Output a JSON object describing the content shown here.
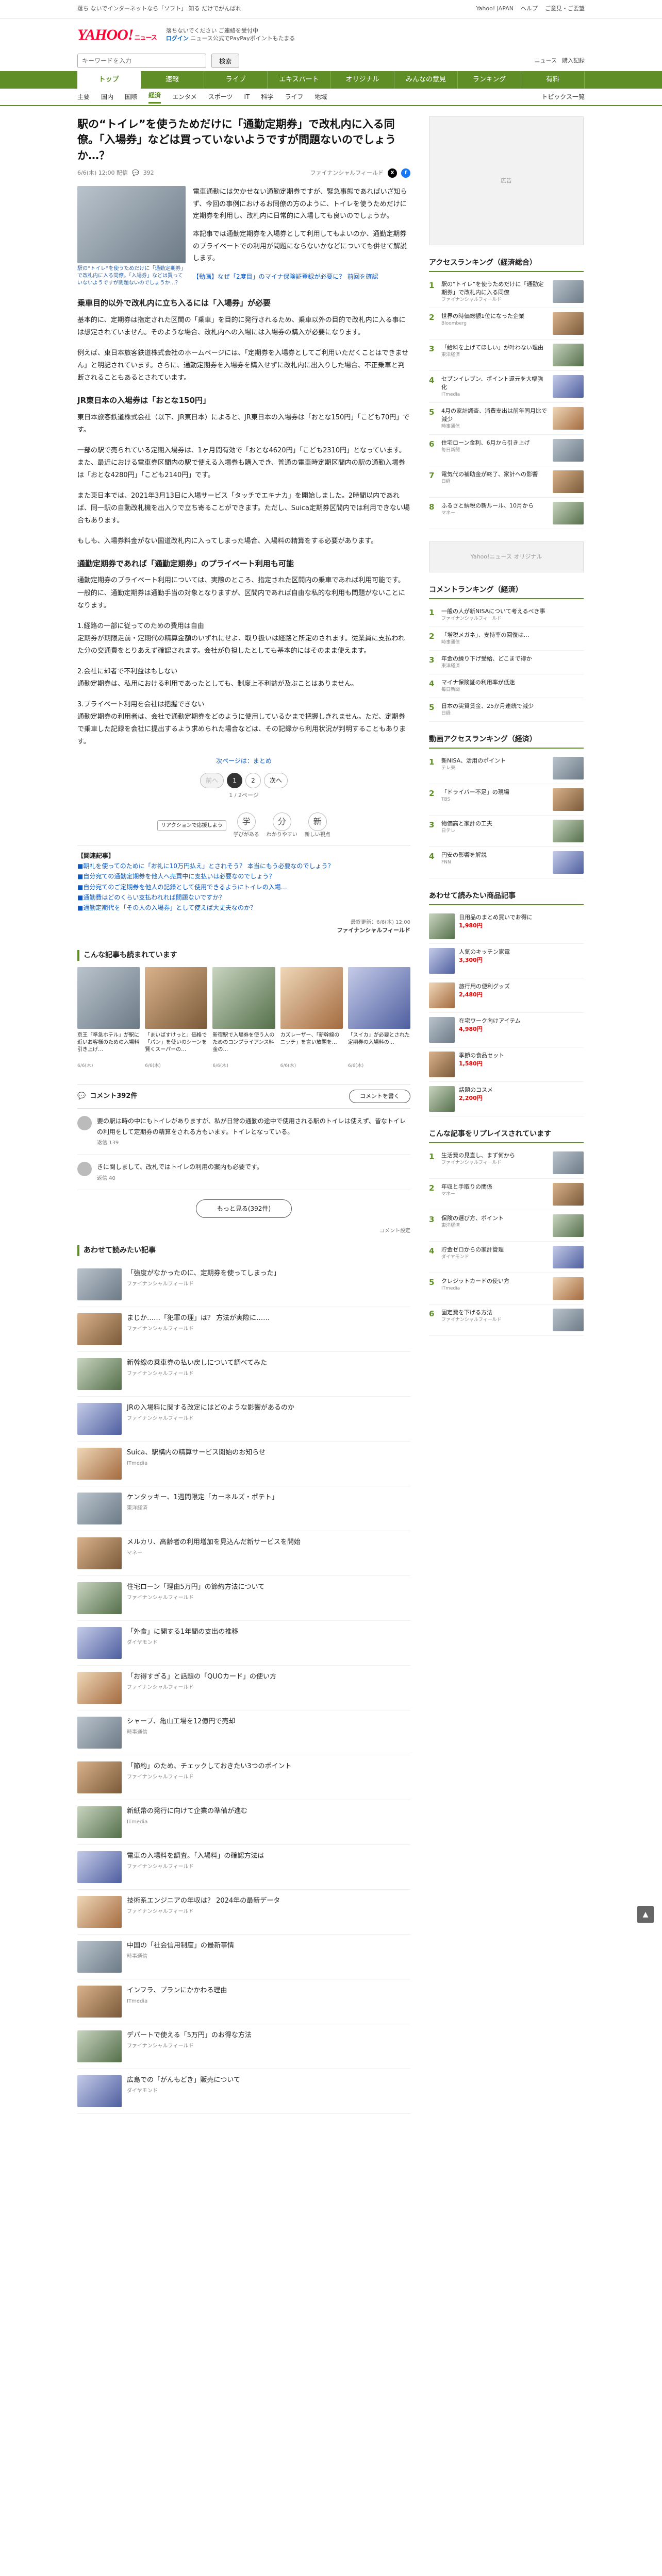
{
  "topbar": {
    "promo": "落ち ないでインターネットなら「ソフト」 知る だけでがんばれ",
    "links": [
      "Yahoo! JAPAN",
      "ヘルプ",
      "ご意見・ご要望"
    ]
  },
  "header": {
    "logo": "YAHOO!",
    "logo_sub": "ニュース",
    "line1": "落ちないでください ご連絡を受付中",
    "line2": "ログイン",
    "line3": "ニュース公式でPayPayポイントもたまる"
  },
  "search": {
    "placeholder": "キーワードを入力",
    "button": "検索",
    "cats": "ニュース",
    "mode": "購入記録"
  },
  "nav": [
    "トップ",
    "速報",
    "ライブ",
    "エキスパート",
    "オリジナル",
    "みんなの意見",
    "ランキング",
    "有料"
  ],
  "subnav": [
    "主要",
    "国内",
    "国際",
    "経済",
    "エンタメ",
    "スポーツ",
    "IT",
    "科学",
    "ライフ",
    "地域"
  ],
  "subnav_active": "経済",
  "subnav_right": "トピックス一覧",
  "article": {
    "title": "駅の“トイレ”を使うためだけに「通勤定期券」で改札内に入る同僚。「入場券」などは買っていないようですが問題ないのでしょうか…？",
    "date": "6/6(木) 12:00 配信",
    "comments_count": "392",
    "source": "ファイナンシャルフィールド",
    "caption": "駅の“トイレ”を使うためだけに「通勤定期券」で改札内に入る同僚。「入場券」などは買っていないようですが問題ないのでしょうか…？",
    "lead_p1": "電車通勤には欠かせない通勤定期券ですが、緊急事態であればいざ知らず、今回の事例におけるお同僚の方のように、トイレを使うためだけに定期券を利用し、改札内に日常的に入場しても良いのでしょうか。",
    "lead_p2": "本記事では通勤定期券を入場券として利用してもよいのか、通勤定期券のプライベートでの利用が問題にならないかなどについても併せて解説します。",
    "lead_link1": "【動画】なぜ「2度目」のマイナ保険証登録が必要に？",
    "lead_link2": "前回を確認",
    "h1": "乗車目的以外で改札内に立ち入るには「入場券」が必要",
    "p1": "基本的に、定期券は指定された区間の「乗車」を目的に発行されるため、乗車以外の目的で改札内に入る事には想定されていません。そのような場合、改札内への入場には入場券の購入が必要になります。",
    "p2": "例えば、東日本旅客鉄道株式会社のホームページには、「定期券を入場券としてご利用いただくことはできません」と明記されています。さらに、通勤定期券を入場券を購入せずに改札内に出入りした場合、不正乗車と判断されることもあるとされています。",
    "h2": "JR東日本の入場券は「おとな150円」",
    "p3": "東日本旅客鉄道株式会社（以下、JR東日本）によると、JR東日本の入場券は「おとな150円」「こども70円」です。",
    "p4": "一部の駅で売られている定期入場券は、1ヶ月間有効で「おとな4620円」「こども2310円」となっています。また、最近における電車券区間内の駅で使える入場券も購入でき、普通の電車時定期区間内の駅の通勤入場券は「おとな4280円」「こども2140円」です。",
    "p5": "また東日本では、2021年3月13日に入場サービス「タッチでエキナカ」を開始しました。2時間以内であれば、同一駅の自動改札機を出入りで立ち寄ることができます。ただし、Suica定期券区間内では利用できない場合もあります。",
    "p6": "もしも、入場券料金がない国道改札内に入ってしまった場合、入場料の精算をする必要があります。",
    "h3": "通勤定期券であれば「通勤定期券」のプライベート利用も可能",
    "p7": "通勤定期券のプライベート利用については、実際のところ、指定された区間内の乗車であれば利用可能です。一般的に、通勤定期券は通勤手当の対象となりますが、区間内であれば自由な私的な利用も問題がないことになります。",
    "p8": "1.経路の一部に従ってのための費用は自由\n定期券が期限走前・定期代の精算金額のいずれにせよ、取り扱いは経路と所定のされます。従業員に支払われた分の交通費をとりあえず確認されます。会社が負担したとしても基本的にはそのまま使えます。",
    "p9": "2.会社に却者で不利益はもしない\n通勤定期券は、私用における利用であったとしても、制度上不利益が及ぶことはありません。",
    "p10": "3.プライベート利用を会社は把握できない\n通勤定期券の利用者は、会社で通勤定期券をどのように使用しているかまで把握しきれません。ただ、定期券で乗車した記録を会社に提出するよう求められた場合などは、その記録から利用状況が判明することもあります。",
    "nextlink": "次ページは：まとめ",
    "pager": {
      "prev": "前へ",
      "p1": "1",
      "p2": "2",
      "next": "次へ",
      "info": "1 / 2ページ"
    },
    "reacts": [
      {
        "icon": "学",
        "label": "学びがある"
      },
      {
        "icon": "分",
        "label": "わかりやすい"
      },
      {
        "icon": "新",
        "label": "新しい視点"
      }
    ],
    "reacts_tip": "リアクションで応援しよう",
    "related_head": "【関連記事】",
    "related": [
      "■朝礼を使ってのために「お礼に10万円払え」とされそう？ 本当にもう必要なのでしょう？",
      "■自分宛ての通勤定期券を他人へ売買中に支払いは必要なのでしょう？",
      "■自分宛てのご定期券を他人の記録として使用できるようにトイレの入場…",
      "■通勤費はどのくらい支払われれば問題ないですか？",
      "■通勤定期代を「その人の入場券」として使えば大丈夫なのか？"
    ],
    "credit_time": "最終更新：6/6(木) 12:00",
    "credit_src": "ファイナンシャルフィールド"
  },
  "readmore": {
    "head": "こんな記事も読まれています",
    "cards": [
      {
        "t": "京王「準急ホテル」が駅に近いお客様のための入場料引き上げ…",
        "d": "6/6(木)"
      },
      {
        "t": "「まいばすけっと」価格で「パン」を使いのシーンを賢くスーパーの…",
        "d": "6/6(木)"
      },
      {
        "t": "新宿駅で入場券を使う人のためのコンプライアンス料金の…",
        "d": "6/6(木)"
      },
      {
        "t": "カズレーザー、「新幹線のニッチ」を言い放題を…",
        "d": "6/6(木)"
      },
      {
        "t": "「スイカ」が必要とされた定期券の入場料の…",
        "d": "6/6(木)"
      }
    ]
  },
  "comments": {
    "head": "コメント392件",
    "write": "コメントを書く",
    "items": [
      {
        "text": "要の駅は時の中にもトイレがありますが、私が日常の通勤の途中で使用される駅のトイレは使えず、皆なトイレの利用をして定期券の精算をされる方もいます。トイレとなっている。",
        "count": "返信 139"
      },
      {
        "text": "きに関しまして、改札ではトイレの利用の案内も必要です。",
        "count": "返信 40"
      }
    ],
    "more": "もっと見る(392件)",
    "mute": "コメント設定"
  },
  "recommend": {
    "head": "あわせて読みたい記事",
    "items": [
      {
        "t": "「強度がなかったのに、定期券を使ってしまった」",
        "s": "ファイナンシャルフィールド"
      },
      {
        "t": "まじか……「犯罪の理」は？ 方法が実際に……",
        "s": "ファイナンシャルフィールド"
      },
      {
        "t": "新幹線の乗車券の払い戻しについて調べてみた",
        "s": "ファイナンシャルフィールド"
      },
      {
        "t": "JRの入場料に関する改定にはどのような影響があるのか",
        "s": "ファイナンシャルフィールド"
      },
      {
        "t": "Suica、駅構内の精算サービス開始のお知らせ",
        "s": "ITmedia"
      },
      {
        "t": "ケンタッキー、1週間限定「カーネルズ・ポテト」",
        "s": "東洋経済"
      },
      {
        "t": "メルカリ、高齢者の利用増加を見込んだ新サービスを開始",
        "s": "マネー"
      },
      {
        "t": "住宅ローン「理由5万円」の節約方法について",
        "s": "ファイナンシャルフィールド"
      },
      {
        "t": "「外食」に関する1年間の支出の推移",
        "s": "ダイヤモンド"
      },
      {
        "t": "「お得すぎる」と話題の「QUOカード」の使い方",
        "s": "ファイナンシャルフィールド"
      },
      {
        "t": "シャープ、亀山工場を12億円で売却",
        "s": "時事通信"
      },
      {
        "t": "「節約」のため、チェックしておきたい3つのポイント",
        "s": "ファイナンシャルフィールド"
      },
      {
        "t": "新紙幣の発行に向けて企業の準備が進む",
        "s": "ITmedia"
      },
      {
        "t": "電車の入場料を調査。「入場料」の確認方法は",
        "s": "ファイナンシャルフィールド"
      },
      {
        "t": "技術系エンジニアの年収は？ 2024年の最新データ",
        "s": "ファイナンシャルフィールド"
      },
      {
        "t": "中国の「社会信用制度」の最新事情",
        "s": "時事通信"
      },
      {
        "t": "インフラ、プランにかかわる理由",
        "s": "ITmedia"
      },
      {
        "t": "デパートで使える「5万円」のお得な方法",
        "s": "ファイナンシャルフィールド"
      },
      {
        "t": "広島での「がんもどき」販売について",
        "s": "ダイヤモンド"
      }
    ]
  },
  "side": {
    "ad1": "広告",
    "access_head": "アクセスランキング（経済総合）",
    "access": [
      {
        "t": "駅の“トイレ”を使うためだけに「通勤定期券」で改札内に入る同僚",
        "s": "ファイナンシャルフィールド"
      },
      {
        "t": "世界の時価総額1位になった企業",
        "s": "Bloomberg"
      },
      {
        "t": "「給料を上げてほしい」が叶わない理由",
        "s": "東洋経済"
      },
      {
        "t": "セブンイレブン、ポイント還元を大幅強化",
        "s": "ITmedia"
      },
      {
        "t": "4月の家計調査、消費支出は前年同月比で減少",
        "s": "時事通信"
      },
      {
        "t": "住宅ローン金利、6月から引き上げ",
        "s": "毎日新聞"
      },
      {
        "t": "電気代の補助金が終了、家計への影響",
        "s": "日経"
      },
      {
        "t": "ふるさと納税の新ルール、10月から",
        "s": "マネー"
      }
    ],
    "orig": "Yahoo!ニュース オリジナル",
    "comment_head": "コメントランキング（経済）",
    "commentrk": [
      {
        "t": "一般の人が新NISAについて考えるべき事",
        "s": "ファイナンシャルフィールド"
      },
      {
        "t": "「増税メガネ」、支持率の回復は…",
        "s": "時事通信"
      },
      {
        "t": "年金の繰り下げ受給、どこまで得か",
        "s": "東洋経済"
      },
      {
        "t": "マイナ保険証の利用率が低迷",
        "s": "毎日新聞"
      },
      {
        "t": "日本の実質賃金、25か月連続で減少",
        "s": "日経"
      }
    ],
    "read_head": "動画アクセスランキング（経済）",
    "readrk": [
      {
        "t": "新NISA、活用のポイント",
        "s": "テレ東"
      },
      {
        "t": "「ドライバー不足」の現場",
        "s": "TBS"
      },
      {
        "t": "物価高と家計の工夫",
        "s": "日テレ"
      },
      {
        "t": "円安の影響を解説",
        "s": "FNN"
      }
    ],
    "shop_head": "あわせて読みたい商品記事",
    "shop": [
      {
        "t": "日用品のまとめ買いでお得に",
        "p": "1,980円"
      },
      {
        "t": "人気のキッチン家電",
        "p": "3,300円"
      },
      {
        "t": "旅行用の便利グッズ",
        "p": "2,480円"
      },
      {
        "t": "在宅ワーク向けアイテム",
        "p": "4,980円"
      },
      {
        "t": "季節の食品セット",
        "p": "1,580円"
      },
      {
        "t": "話題のコスメ",
        "p": "2,200円"
      }
    ],
    "topic_head": "こんな記事をリプレイスされています",
    "topic": [
      {
        "t": "生活費の見直し、まず何から",
        "s": "ファイナンシャルフィールド"
      },
      {
        "t": "年収と手取りの関係",
        "s": "マネー"
      },
      {
        "t": "保険の選び方、ポイント",
        "s": "東洋経済"
      },
      {
        "t": "貯金ゼロからの家計管理",
        "s": "ダイヤモンド"
      },
      {
        "t": "クレジットカードの使い方",
        "s": "ITmedia"
      },
      {
        "t": "固定費を下げる方法",
        "s": "ファイナンシャルフィールド"
      }
    ]
  },
  "pagetop": "▲"
}
